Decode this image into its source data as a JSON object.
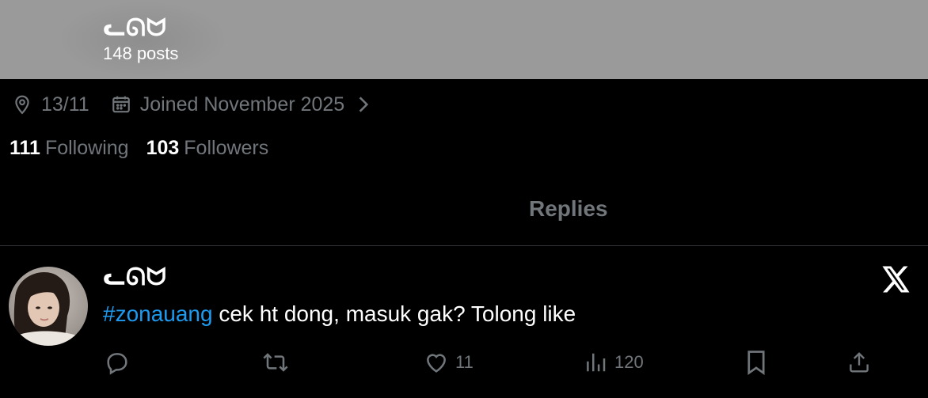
{
  "header": {
    "name": "ᓚᘏᗢ",
    "posts": "148 posts"
  },
  "profile": {
    "location": "13/11",
    "joined": "Joined November 2025",
    "following_count": "111",
    "following_label": "Following",
    "followers_count": "103",
    "followers_label": "Followers"
  },
  "tabs": {
    "active": "Replies"
  },
  "post": {
    "author": "ᓚᘏᗢ",
    "hashtag": "#zonauang",
    "text": " cek ht dong, masuk gak? Tolong like",
    "likes": "11",
    "views": "120",
    "hashtag_color": "#1d9bf0"
  },
  "icons": {
    "location": "location-pin-icon",
    "calendar": "calendar-icon",
    "chevron": "chevron-right-icon",
    "reply": "reply-icon",
    "repost": "repost-icon",
    "like": "heart-icon",
    "views": "views-icon",
    "bookmark": "bookmark-icon",
    "share": "share-icon",
    "x_logo": "x-logo-icon"
  }
}
